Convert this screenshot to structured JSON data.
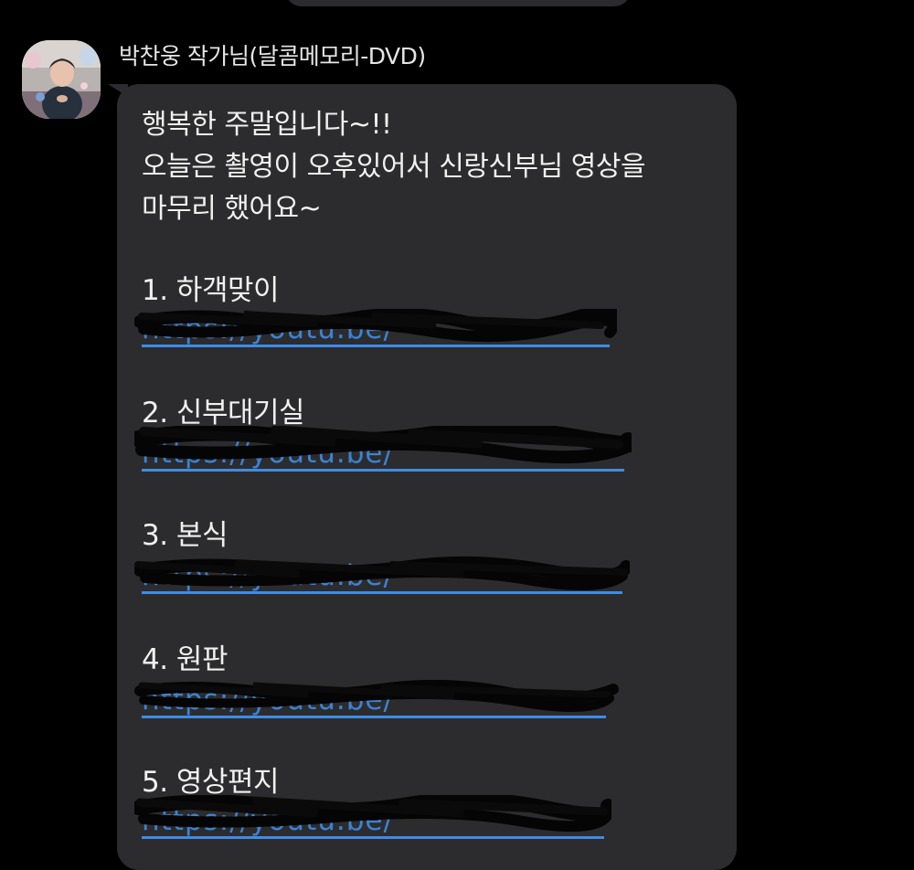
{
  "chat": {
    "sender": {
      "name": "박찬웅 작가님(달콤메모리-DVD)"
    },
    "message": {
      "intro_lines": [
        "행복한 주말입니다~!!",
        "오늘은 촬영이 오후있어서 신랑신부님 영상을",
        "마무리 했어요~"
      ],
      "items": [
        {
          "title": "1. 하객맞이",
          "link": "https://youtu.be/"
        },
        {
          "title": "2. 신부대기실",
          "link": "https://youtu.be/"
        },
        {
          "title": "3. 본식",
          "link": "https://youtu.be/"
        },
        {
          "title": "4. 원판",
          "link": "https://youtu.be/"
        },
        {
          "title": "5. 영상편지",
          "link": "https://youtu.be/"
        }
      ]
    }
  },
  "icons": {
    "avatar": "profile-photo"
  },
  "colors": {
    "background": "#000000",
    "bubble": "#2c2c2e",
    "text": "#f0f0f0",
    "link": "#3e8ce6",
    "redaction": "#050505"
  }
}
